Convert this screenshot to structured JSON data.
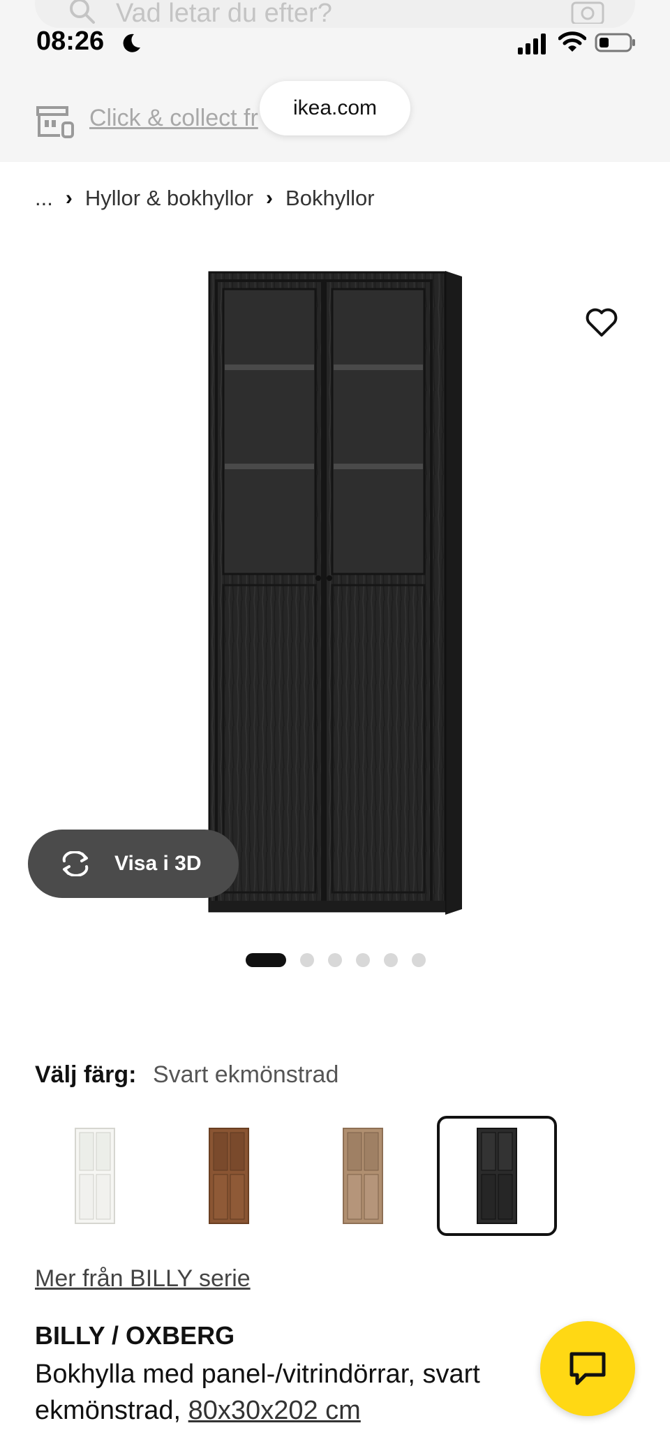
{
  "status_bar": {
    "time": "08:26"
  },
  "search": {
    "placeholder": "Vad letar du efter?"
  },
  "header": {
    "click_collect": "Click & collect fr",
    "url": "ikea.com"
  },
  "breadcrumb": {
    "ellipsis": "...",
    "items": [
      "Hyllor & bokhyllor",
      "Bokhyllor"
    ]
  },
  "gallery": {
    "view3d_label": "Visa i 3D",
    "dot_count": 6,
    "active_dot": 0
  },
  "color": {
    "label": "Välj färg:",
    "value": "Svart ekmönstrad",
    "swatches": [
      {
        "name": "white",
        "color": "#f3f3f0",
        "selected": false
      },
      {
        "name": "brown-walnut",
        "color": "#8a5533",
        "selected": false
      },
      {
        "name": "oak",
        "color": "#b08f70",
        "selected": false
      },
      {
        "name": "black-oak",
        "color": "#2b2b2b",
        "selected": true
      }
    ]
  },
  "more_link": "Mer från BILLY serie",
  "product": {
    "name": "BILLY / OXBERG",
    "description": "Bokhylla med panel-/vitrindörrar, svart ekmönstrad,",
    "dimensions": "80x30x202 cm"
  },
  "icons": [
    "search-icon",
    "camera-icon",
    "moon-icon",
    "signal-icon",
    "wifi-icon",
    "battery-icon",
    "store-icon",
    "heart-icon",
    "rotate-3d-icon",
    "chat-icon"
  ],
  "colors": {
    "accent_yellow": "#ffd814",
    "pill_dark": "#4b4b4b"
  }
}
